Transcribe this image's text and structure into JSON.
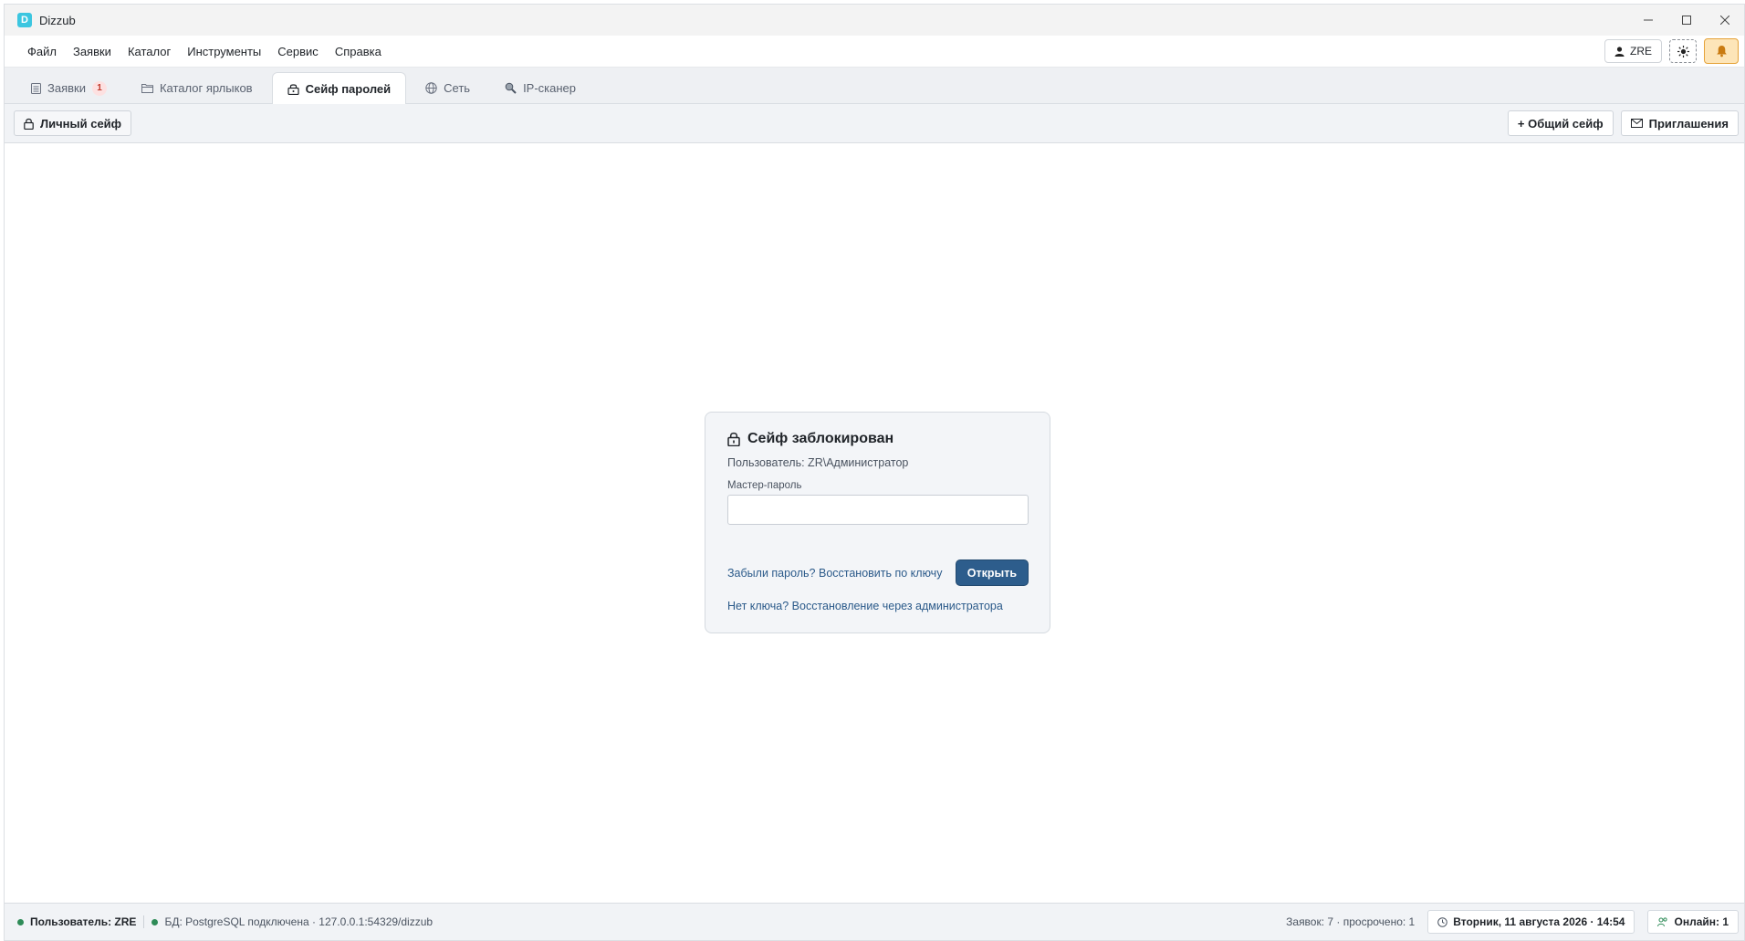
{
  "window": {
    "title": "Dizzub",
    "logo_letter": "D"
  },
  "menu": {
    "items": [
      "Файл",
      "Заявки",
      "Каталог",
      "Инструменты",
      "Сервис",
      "Справка"
    ]
  },
  "header_right": {
    "user_label": "ZRE"
  },
  "tabs": [
    {
      "label": "Заявки",
      "badge": "1",
      "icon": "clipboard-icon"
    },
    {
      "label": "Каталог ярлыков",
      "icon": "folder-icon"
    },
    {
      "label": "Сейф паролей",
      "icon": "safe-icon",
      "active": true
    },
    {
      "label": "Сеть",
      "icon": "globe-icon"
    },
    {
      "label": "IP-сканер",
      "icon": "magnifier-icon"
    }
  ],
  "toolbar": {
    "personal_safe": "Личный сейф",
    "shared_safe": "+ Общий сейф",
    "invitations": "Приглашения"
  },
  "lock_card": {
    "title": "Сейф заблокирован",
    "user_line": "Пользователь: ZR\\Администратор",
    "password_label": "Мастер-пароль",
    "password_value": "",
    "forgot_link": "Забыли пароль? Восстановить по ключу",
    "open_button": "Открыть",
    "no_key_link": "Нет ключа? Восстановление через администратора"
  },
  "status": {
    "user": "Пользователь: ZRE",
    "db": "БД: PostgreSQL подключена · 127.0.0.1:54329/dizzub",
    "tickets": "Заявок: 7 · просрочено: 1",
    "datetime": "Вторник, 11 августа 2026 · 14:54",
    "online": "Онлайн: 1"
  },
  "colors": {
    "accent": "#2d5d8c",
    "status_ok": "#2e8b57",
    "bell_bg": "#fde5b8"
  }
}
